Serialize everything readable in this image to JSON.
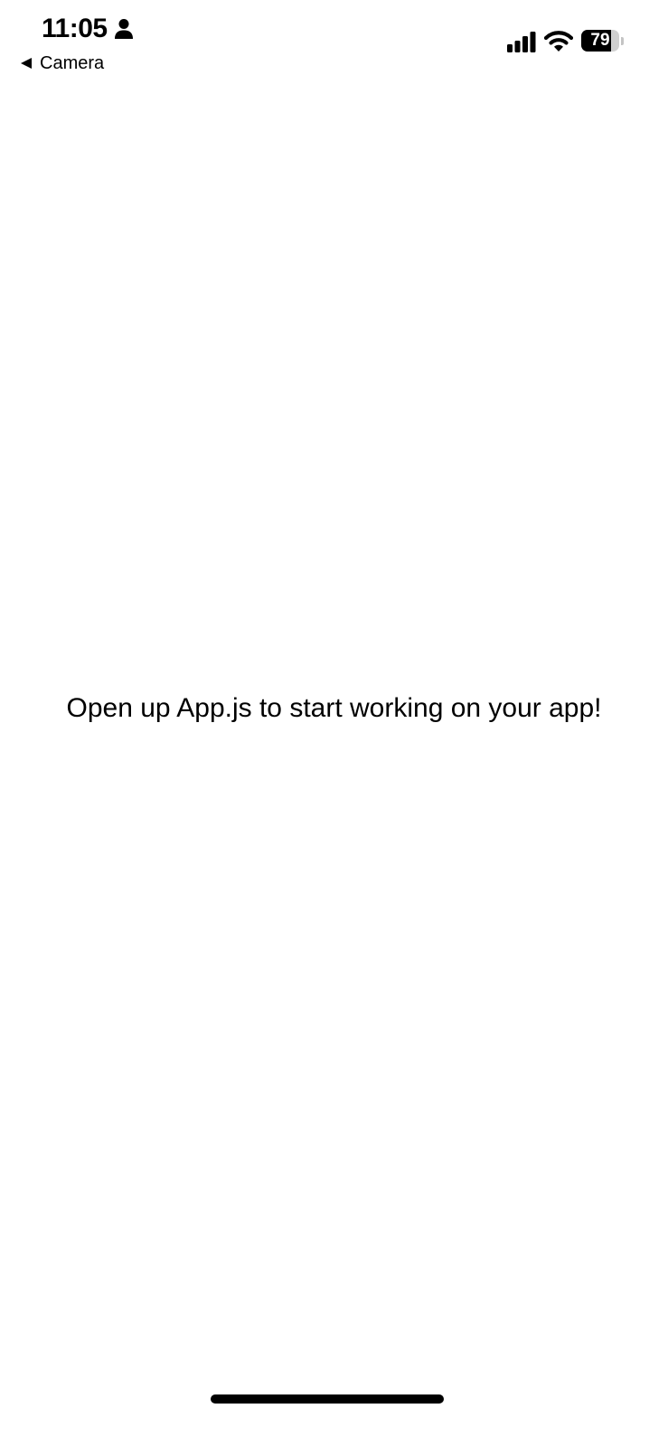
{
  "status_bar": {
    "time": "11:05",
    "back_label": "Camera",
    "battery_percent": 79,
    "battery_level": 0.79,
    "icons": [
      "person-icon",
      "back-arrow-icon",
      "cellular-signal-icon",
      "wifi-icon",
      "battery-icon"
    ]
  },
  "main": {
    "message": "Open up App.js to start working on your app!"
  },
  "colors": {
    "background": "#ffffff",
    "text": "#000000"
  }
}
